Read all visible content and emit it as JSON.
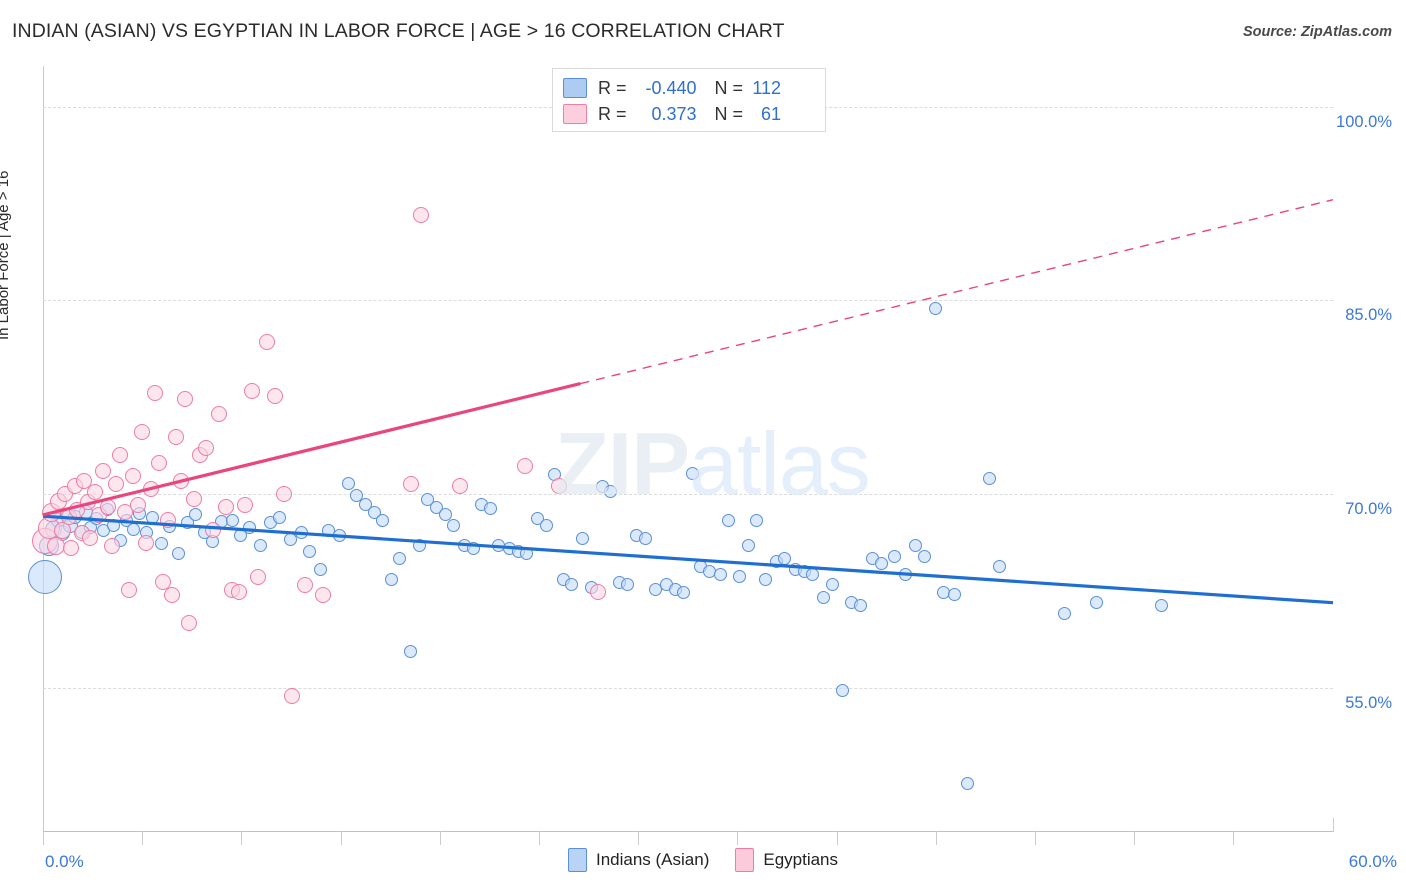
{
  "header": {
    "title": "INDIAN (ASIAN) VS EGYPTIAN IN LABOR FORCE | AGE > 16 CORRELATION CHART",
    "source": "Source: ZipAtlas.com"
  },
  "watermark": {
    "bold": "ZIP",
    "light": "atlas"
  },
  "stats": {
    "rows": [
      {
        "series": "Indians (Asian)",
        "swatch": "blue",
        "r_label": "R =",
        "r_value": "-0.440",
        "n_label": "N =",
        "n_value": "112"
      },
      {
        "series": "Egyptians",
        "swatch": "pink",
        "r_label": "R =",
        "r_value": "0.373",
        "n_label": "N =",
        "n_value": "61"
      }
    ]
  },
  "legend": {
    "items": [
      {
        "label": "Indians (Asian)",
        "color": "#b9d3f5"
      },
      {
        "label": "Egyptians",
        "color": "#fbcbdb"
      }
    ]
  },
  "axes": {
    "y_title": "In Labor Force | Age > 16",
    "y_ticks": [
      "100.0%",
      "85.0%",
      "70.0%",
      "55.0%"
    ],
    "x_min": "0.0%",
    "x_max": "60.0%"
  },
  "chart_data": {
    "type": "scatter",
    "title": "INDIAN (ASIAN) VS EGYPTIAN IN LABOR FORCE | AGE > 16 CORRELATION CHART",
    "xlabel": "",
    "ylabel": "In Labor Force | Age > 16",
    "xlim": [
      0,
      60
    ],
    "ylim": [
      44.0,
      103.0
    ],
    "x_ticks": [
      0,
      60
    ],
    "y_ticks": [
      55,
      70,
      85,
      100
    ],
    "grid": "horizontal-dashed",
    "legend_position": "bottom-center",
    "series": [
      {
        "name": "Indians (Asian)",
        "color": "#b9d3f5",
        "border_color": "#5b8fd6",
        "r": -0.44,
        "n": 112,
        "trendline": {
          "style": "solid",
          "x0": 0,
          "y0": 68.3,
          "x1": 60,
          "y1": 61.6,
          "color": "#1f6fd0"
        },
        "points": [
          [
            0.1,
            63.6,
            34
          ],
          [
            0.3,
            66.0,
            20
          ],
          [
            0.5,
            67.3,
            17
          ],
          [
            0.7,
            68.0,
            15
          ],
          [
            0.9,
            67.0,
            16
          ],
          [
            1.1,
            68.4,
            14
          ],
          [
            1.3,
            67.6,
            15
          ],
          [
            1.5,
            68.2,
            14
          ],
          [
            1.8,
            67.1,
            14
          ],
          [
            2.0,
            68.6,
            14
          ],
          [
            2.2,
            67.4,
            13
          ],
          [
            2.5,
            68.1,
            13
          ],
          [
            2.8,
            67.2,
            13
          ],
          [
            3.0,
            68.8,
            13
          ],
          [
            3.3,
            67.6,
            13
          ],
          [
            3.6,
            66.4,
            13
          ],
          [
            3.9,
            68.0,
            13
          ],
          [
            4.2,
            67.3,
            13
          ],
          [
            4.5,
            68.5,
            13
          ],
          [
            4.8,
            67.0,
            13
          ],
          [
            5.1,
            68.2,
            13
          ],
          [
            5.5,
            66.2,
            13
          ],
          [
            5.9,
            67.5,
            13
          ],
          [
            6.3,
            65.4,
            13
          ],
          [
            6.7,
            67.8,
            13
          ],
          [
            7.1,
            68.4,
            13
          ],
          [
            7.5,
            67.0,
            13
          ],
          [
            7.9,
            66.3,
            13
          ],
          [
            8.3,
            67.9,
            13
          ],
          [
            8.8,
            68.0,
            13
          ],
          [
            9.2,
            66.8,
            13
          ],
          [
            9.6,
            67.4,
            13
          ],
          [
            10.1,
            66.0,
            13
          ],
          [
            10.6,
            67.8,
            13
          ],
          [
            11.0,
            68.2,
            13
          ],
          [
            11.5,
            66.5,
            13
          ],
          [
            12.0,
            67.0,
            13
          ],
          [
            12.4,
            65.6,
            13
          ],
          [
            12.9,
            64.2,
            13
          ],
          [
            13.3,
            67.2,
            13
          ],
          [
            13.8,
            66.8,
            13
          ],
          [
            14.2,
            70.8,
            13
          ],
          [
            14.6,
            69.9,
            13
          ],
          [
            15.0,
            69.2,
            13
          ],
          [
            15.4,
            68.6,
            13
          ],
          [
            15.8,
            68.0,
            13
          ],
          [
            16.2,
            63.4,
            13
          ],
          [
            16.6,
            65.0,
            13
          ],
          [
            17.1,
            57.8,
            13
          ],
          [
            17.5,
            66.0,
            13
          ],
          [
            17.9,
            69.6,
            13
          ],
          [
            18.3,
            69.0,
            13
          ],
          [
            18.7,
            68.4,
            13
          ],
          [
            19.1,
            67.6,
            13
          ],
          [
            19.6,
            66.0,
            13
          ],
          [
            20.0,
            65.8,
            13
          ],
          [
            20.4,
            69.2,
            13
          ],
          [
            20.8,
            68.9,
            13
          ],
          [
            21.2,
            66.0,
            13
          ],
          [
            21.7,
            65.8,
            13
          ],
          [
            22.1,
            65.6,
            13
          ],
          [
            22.5,
            65.4,
            13
          ],
          [
            23.0,
            68.1,
            13
          ],
          [
            23.4,
            67.6,
            13
          ],
          [
            23.8,
            71.5,
            13
          ],
          [
            24.2,
            63.4,
            13
          ],
          [
            24.6,
            63.0,
            13
          ],
          [
            25.1,
            66.6,
            13
          ],
          [
            25.5,
            62.8,
            13
          ],
          [
            26.0,
            70.6,
            13
          ],
          [
            26.4,
            70.2,
            13
          ],
          [
            26.8,
            63.2,
            13
          ],
          [
            27.2,
            63.0,
            13
          ],
          [
            27.6,
            66.8,
            13
          ],
          [
            28.0,
            66.6,
            13
          ],
          [
            28.5,
            62.6,
            13
          ],
          [
            29.0,
            63.0,
            13
          ],
          [
            29.4,
            62.6,
            13
          ],
          [
            29.8,
            62.4,
            13
          ],
          [
            30.2,
            71.6,
            13
          ],
          [
            30.6,
            64.4,
            13
          ],
          [
            31.0,
            64.0,
            13
          ],
          [
            31.5,
            63.8,
            13
          ],
          [
            31.9,
            68.0,
            13
          ],
          [
            32.4,
            63.6,
            13
          ],
          [
            32.8,
            66.0,
            13
          ],
          [
            33.2,
            68.0,
            13
          ],
          [
            33.6,
            63.4,
            13
          ],
          [
            34.1,
            64.8,
            13
          ],
          [
            34.5,
            65.0,
            13
          ],
          [
            35.0,
            64.2,
            13
          ],
          [
            35.4,
            64.0,
            13
          ],
          [
            35.8,
            63.8,
            13
          ],
          [
            36.3,
            62.0,
            13
          ],
          [
            36.7,
            63.0,
            13
          ],
          [
            37.2,
            54.8,
            13
          ],
          [
            37.6,
            61.6,
            13
          ],
          [
            38.0,
            61.4,
            13
          ],
          [
            38.6,
            65.0,
            13
          ],
          [
            39.0,
            64.6,
            13
          ],
          [
            39.6,
            65.2,
            13
          ],
          [
            40.1,
            63.8,
            13
          ],
          [
            40.6,
            66.0,
            13
          ],
          [
            41.0,
            65.2,
            13
          ],
          [
            41.5,
            84.4,
            13
          ],
          [
            41.9,
            62.4,
            13
          ],
          [
            42.4,
            62.2,
            13
          ],
          [
            43.0,
            47.6,
            13
          ],
          [
            44.0,
            71.2,
            13
          ],
          [
            44.5,
            64.4,
            13
          ],
          [
            47.5,
            60.8,
            13
          ],
          [
            49.0,
            61.6,
            13
          ],
          [
            52.0,
            61.4,
            13
          ]
        ]
      },
      {
        "name": "Egyptians",
        "color": "#fbcbdb",
        "border_color": "#ee7ca3",
        "r": 0.373,
        "n": 61,
        "trendline": {
          "style": "solid-then-dashed",
          "x0": 0,
          "y0": 68.4,
          "x_break": 25.0,
          "x1": 60,
          "y1": 92.8,
          "color": "#e8467c"
        },
        "points": [
          [
            0.1,
            66.4,
            26
          ],
          [
            0.3,
            67.4,
            22
          ],
          [
            0.4,
            68.6,
            19
          ],
          [
            0.6,
            66.0,
            18
          ],
          [
            0.7,
            69.4,
            17
          ],
          [
            0.9,
            67.2,
            17
          ],
          [
            1.0,
            70.0,
            16
          ],
          [
            1.2,
            68.2,
            16
          ],
          [
            1.3,
            65.8,
            16
          ],
          [
            1.5,
            70.6,
            16
          ],
          [
            1.6,
            68.8,
            16
          ],
          [
            1.8,
            67.0,
            16
          ],
          [
            1.9,
            71.0,
            16
          ],
          [
            2.1,
            69.4,
            16
          ],
          [
            2.2,
            66.6,
            16
          ],
          [
            2.4,
            70.2,
            16
          ],
          [
            2.6,
            68.4,
            16
          ],
          [
            2.8,
            71.8,
            16
          ],
          [
            3.0,
            69.0,
            16
          ],
          [
            3.2,
            66.0,
            16
          ],
          [
            3.4,
            70.8,
            16
          ],
          [
            3.6,
            73.0,
            16
          ],
          [
            3.8,
            68.6,
            16
          ],
          [
            4.0,
            62.6,
            16
          ],
          [
            4.2,
            71.4,
            16
          ],
          [
            4.4,
            69.2,
            16
          ],
          [
            4.6,
            74.8,
            16
          ],
          [
            4.8,
            66.2,
            16
          ],
          [
            5.0,
            70.4,
            16
          ],
          [
            5.2,
            77.8,
            16
          ],
          [
            5.4,
            72.4,
            16
          ],
          [
            5.6,
            63.2,
            16
          ],
          [
            5.8,
            68.0,
            16
          ],
          [
            6.0,
            62.2,
            16
          ],
          [
            6.2,
            74.4,
            16
          ],
          [
            6.4,
            71.0,
            16
          ],
          [
            6.6,
            77.4,
            16
          ],
          [
            6.8,
            60.0,
            16
          ],
          [
            7.0,
            69.6,
            16
          ],
          [
            7.3,
            73.0,
            16
          ],
          [
            7.6,
            73.6,
            16
          ],
          [
            7.9,
            67.2,
            16
          ],
          [
            8.2,
            76.2,
            16
          ],
          [
            8.5,
            69.0,
            16
          ],
          [
            8.8,
            62.6,
            16
          ],
          [
            9.1,
            62.4,
            16
          ],
          [
            9.4,
            69.2,
            16
          ],
          [
            9.7,
            78.0,
            16
          ],
          [
            10.0,
            63.6,
            16
          ],
          [
            10.4,
            81.8,
            16
          ],
          [
            10.8,
            77.6,
            16
          ],
          [
            11.2,
            70.0,
            16
          ],
          [
            11.6,
            54.4,
            16
          ],
          [
            12.2,
            63.0,
            16
          ],
          [
            13.0,
            62.2,
            16
          ],
          [
            17.6,
            91.6,
            16
          ],
          [
            17.1,
            70.8,
            16
          ],
          [
            19.4,
            70.6,
            16
          ],
          [
            22.4,
            72.2,
            16
          ],
          [
            24.0,
            70.6,
            16
          ],
          [
            25.8,
            62.4,
            16
          ]
        ]
      }
    ]
  }
}
